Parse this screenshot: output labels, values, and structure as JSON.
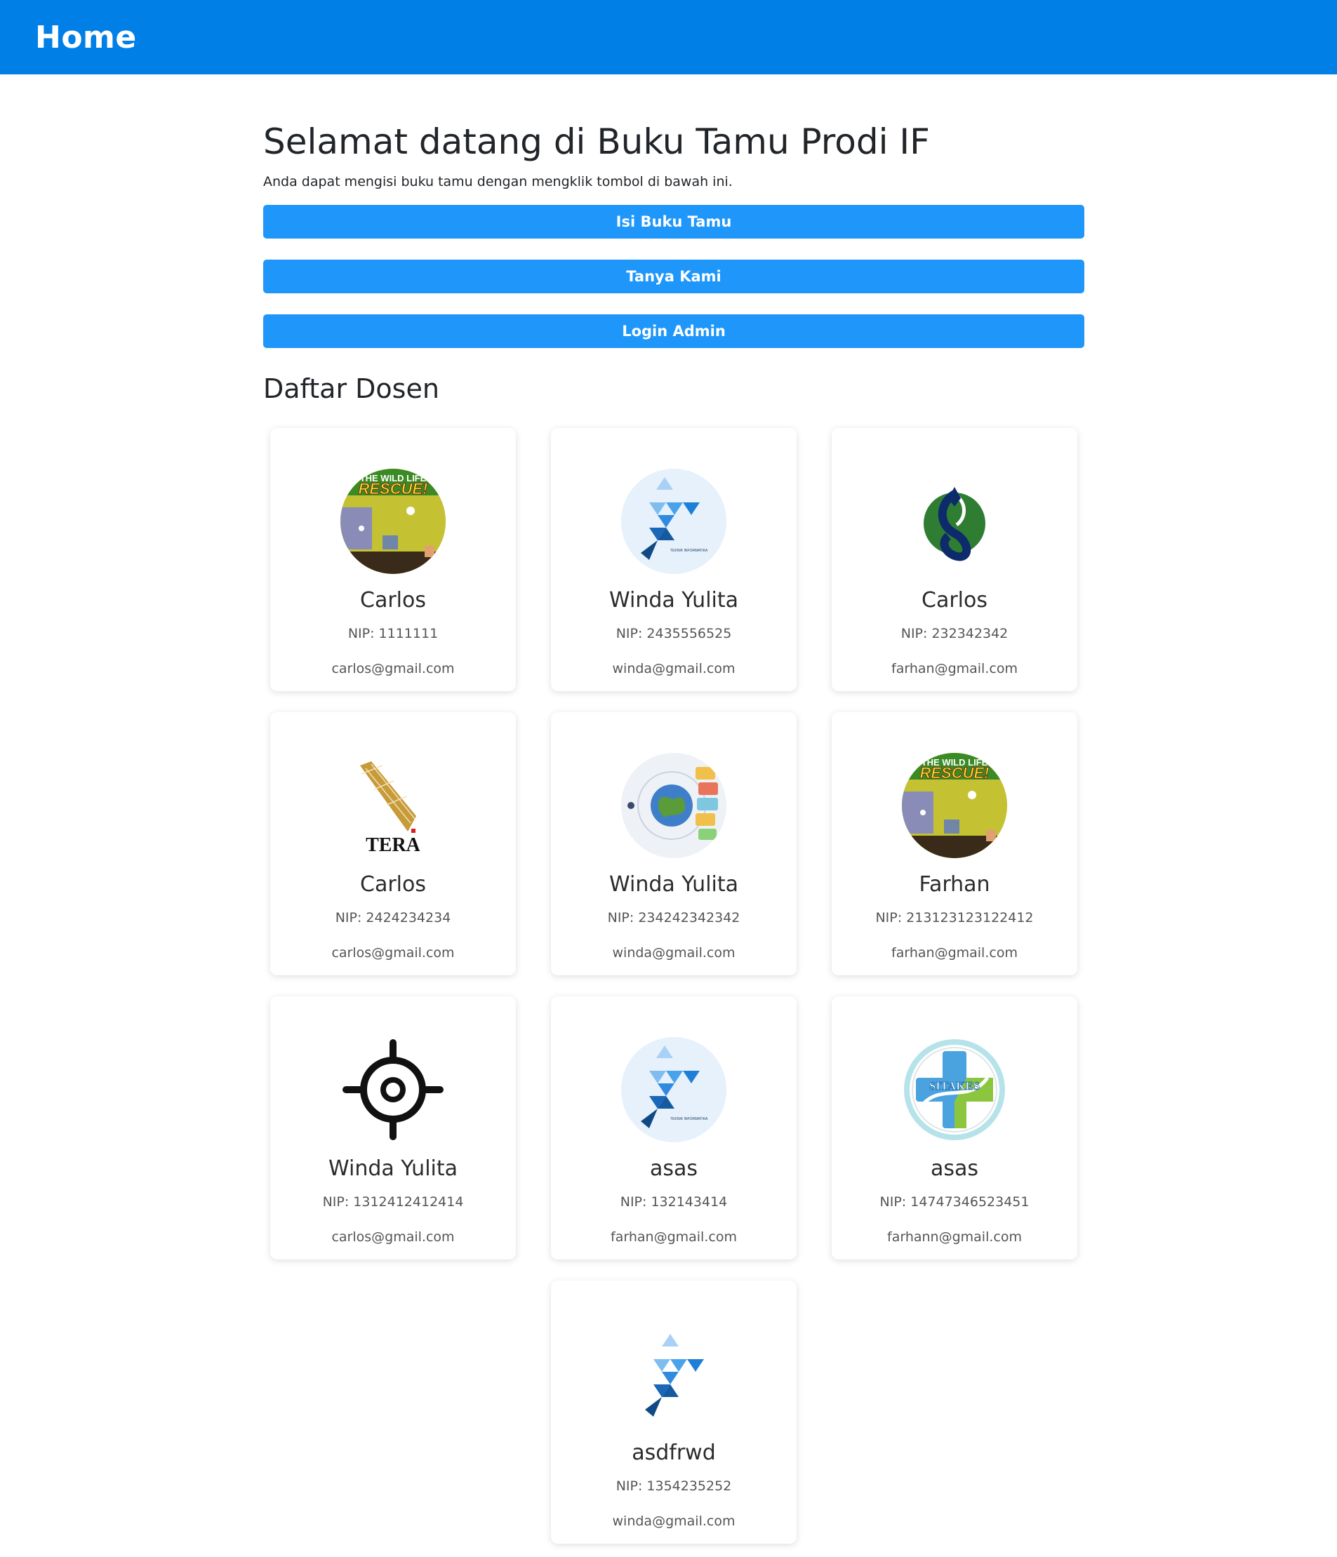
{
  "navbar": {
    "title": "Home"
  },
  "welcome": {
    "title": "Selamat datang di Buku Tamu Prodi IF",
    "subtitle": "Anda dapat mengisi buku tamu dengan mengklik tombol di bawah ini."
  },
  "buttons": {
    "guestbook": "Isi Buku Tamu",
    "ask": "Tanya Kami",
    "admin": "Login Admin"
  },
  "section": {
    "title": "Daftar Dosen"
  },
  "lecturers": [
    {
      "name": "Carlos",
      "nip": "NIP: 1111111",
      "email": "carlos@gmail.com",
      "avatar": "wildlife-rescue-game-image"
    },
    {
      "name": "Winda Yulita",
      "nip": "NIP: 2435556525",
      "email": "winda@gmail.com",
      "avatar": "teknik-informatika-logo"
    },
    {
      "name": "Carlos",
      "nip": "NIP: 232342342",
      "email": "farhan@gmail.com",
      "avatar": "swirl-logo"
    },
    {
      "name": "Carlos",
      "nip": "NIP: 2424234234",
      "email": "carlos@gmail.com",
      "avatar": "sumatera-map-logo"
    },
    {
      "name": "Winda Yulita",
      "nip": "NIP: 234242342342",
      "email": "winda@gmail.com",
      "avatar": "globe-illustration"
    },
    {
      "name": "Farhan",
      "nip": "NIP: 213123123122412",
      "email": "farhan@gmail.com",
      "avatar": "wildlife-rescue-game-image"
    },
    {
      "name": "Winda Yulita",
      "nip": "NIP: 1312412412414",
      "email": "carlos@gmail.com",
      "avatar": "crosshair-icon"
    },
    {
      "name": "asas",
      "nip": "NIP: 132143414",
      "email": "farhan@gmail.com",
      "avatar": "teknik-informatika-logo"
    },
    {
      "name": "asas",
      "nip": "NIP: 14747346523451",
      "email": "farhann@gmail.com",
      "avatar": "sitakes-logo"
    },
    {
      "name": "asdfrwd",
      "nip": "NIP: 1354235252",
      "email": "winda@gmail.com",
      "avatar": "f-logo"
    }
  ],
  "logo_texts": {
    "game_line1": "THE WILD LIFE",
    "game_line2": "RESCUE!",
    "teknik": "TEKNIK INFORMATIKA",
    "sumatera": "TERA",
    "sitakes": "SITAKES"
  },
  "colors": {
    "navbar": "#0080e6",
    "button": "#1e96fa"
  }
}
